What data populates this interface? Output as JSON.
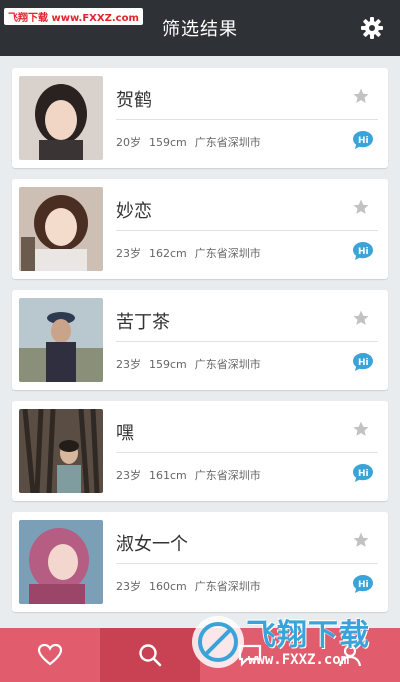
{
  "watermark": {
    "text": "飞翔下载 www.FXXZ.com"
  },
  "header": {
    "title": "筛选结果",
    "settings_icon": "gear-icon"
  },
  "colors": {
    "header": "#2e3135",
    "accent": "#e15c6d",
    "accent_active": "#c94253",
    "chat": "#3aa3d8"
  },
  "results": [
    {
      "name": "贺鹤",
      "age": "20岁",
      "height": "159cm",
      "location": "广东省深圳市"
    },
    {
      "name": "妙恋",
      "age": "23岁",
      "height": "162cm",
      "location": "广东省深圳市"
    },
    {
      "name": "苦丁茶",
      "age": "23岁",
      "height": "159cm",
      "location": "广东省深圳市"
    },
    {
      "name": "嘿",
      "age": "23岁",
      "height": "161cm",
      "location": "广东省深圳市"
    },
    {
      "name": "淑女一个",
      "age": "23岁",
      "height": "160cm",
      "location": "广东省深圳市"
    }
  ],
  "tabbar": {
    "items": [
      "heart-icon",
      "search-icon",
      "chat-icon",
      "profile-icon"
    ]
  },
  "brand_overlay": {
    "name": "飞翔下载",
    "url": "www.FXXZ.com"
  }
}
